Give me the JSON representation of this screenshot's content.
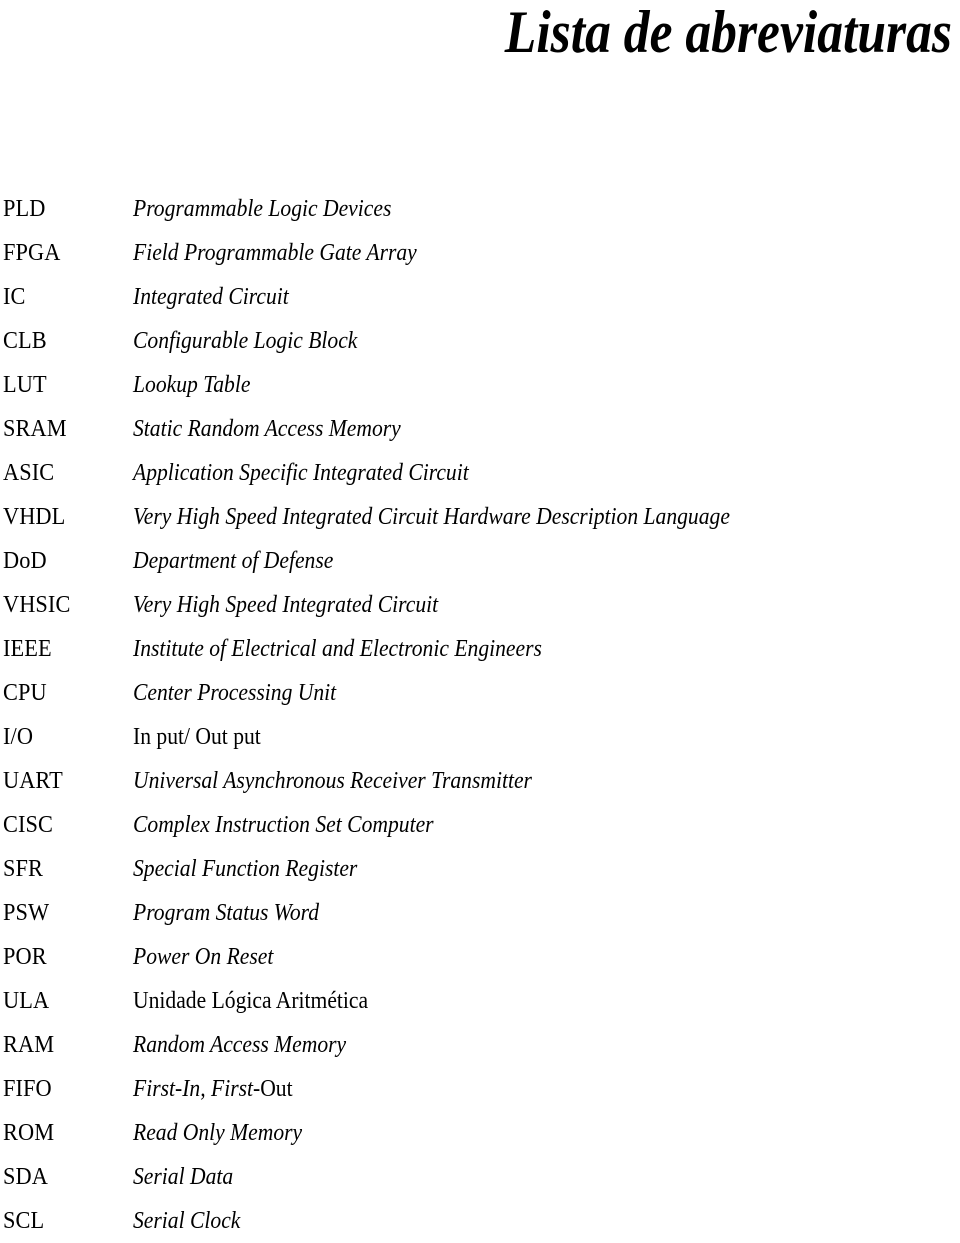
{
  "page": {
    "title": "Lista de abreviaturas",
    "background_color": "#ffffff",
    "text_color": "#000000"
  },
  "abbreviations": [
    {
      "term": "PLD",
      "definition": "Programmable Logic Devices",
      "style": "italic"
    },
    {
      "term": "FPGA",
      "definition": "Field Programmable Gate Array",
      "style": "italic"
    },
    {
      "term": "IC",
      "definition": "Integrated Circuit",
      "style": "italic"
    },
    {
      "term": "CLB",
      "definition": "Configurable Logic Block",
      "style": "italic"
    },
    {
      "term": "LUT",
      "definition": "Lookup Table",
      "style": "italic"
    },
    {
      "term": "SRAM",
      "definition": "Static Random Access Memory",
      "style": "italic"
    },
    {
      "term": "ASIC",
      "definition": "Application Specific Integrated Circuit",
      "style": "italic"
    },
    {
      "term": "VHDL",
      "definition": "Very High Speed Integrated Circuit Hardware Description Language",
      "style": "italic"
    },
    {
      "term": "DoD",
      "definition": "Department of Defense",
      "style": "italic"
    },
    {
      "term": "VHSIC",
      "definition": "Very High Speed Integrated Circuit",
      "style": "italic"
    },
    {
      "term": "IEEE",
      "definition": "Institute of Electrical and Electronic Engineers",
      "style": "italic"
    },
    {
      "term": "CPU",
      "definition": "Center Processing Unit",
      "style": "italic"
    },
    {
      "term": "I/O",
      "definition": "In put/ Out put",
      "style": "upright"
    },
    {
      "term": "UART",
      "definition": "Universal Asynchronous Receiver Transmitter",
      "style": "italic"
    },
    {
      "term": "CISC",
      "definition": "Complex Instruction Set Computer",
      "style": "italic"
    },
    {
      "term": "SFR",
      "definition": "Special Function Register",
      "style": "italic"
    },
    {
      "term": "PSW",
      "definition": "Program Status Word",
      "style": "italic"
    },
    {
      "term": "POR",
      "definition": "Power On Reset",
      "style": "italic"
    },
    {
      "term": "ULA",
      "definition": "Unidade Lógica Aritmética",
      "style": "upright"
    },
    {
      "term": "RAM",
      "definition": "Random Access Memory",
      "style": "italic"
    },
    {
      "term": "FIFO",
      "definition": "First-In, First-Out",
      "definition_italic_part": "First-In, First-",
      "definition_roman_part": "Out",
      "style": "mixed"
    },
    {
      "term": "ROM",
      "definition": "Read Only Memory",
      "style": "italic"
    },
    {
      "term": "SDA",
      "definition": "Serial Data",
      "style": "italic"
    },
    {
      "term": "SCL",
      "definition": "Serial Clock",
      "style": "italic"
    }
  ]
}
